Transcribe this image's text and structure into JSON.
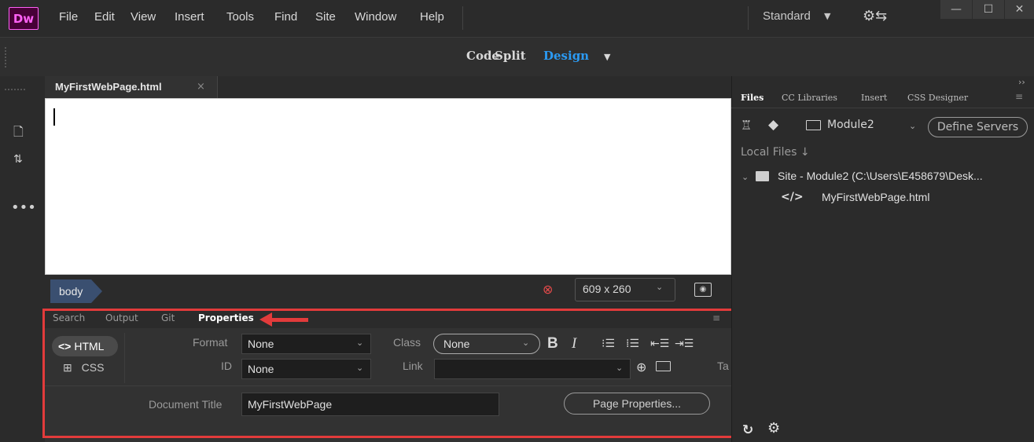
{
  "app": {
    "logo": "Dw",
    "menu": [
      "File",
      "Edit",
      "View",
      "Insert",
      "Tools",
      "Find",
      "Site",
      "Window",
      "Help"
    ],
    "workspace": "Standard",
    "window_buttons": [
      "—",
      "☐",
      "✕"
    ]
  },
  "view_toggle": {
    "code": "Code",
    "split": "Split",
    "design": "Design",
    "active": "Design",
    "active_color": "#2b9af3"
  },
  "document": {
    "tab_label": "MyFirstWebPage.html",
    "close_glyph": "×"
  },
  "status": {
    "tag": "body",
    "size": "609 x 260"
  },
  "properties_panel": {
    "tabs": [
      "Search",
      "Output",
      "Git",
      "Properties"
    ],
    "active_tab": "Properties",
    "html_label": "HTML",
    "css_label": "CSS",
    "format_label": "Format",
    "format_value": "None",
    "id_label": "ID",
    "id_value": "None",
    "class_label": "Class",
    "class_value": "None",
    "link_label": "Link",
    "link_value": "",
    "target_label": "Ta",
    "bold": "B",
    "italic": "I",
    "document_title_label": "Document Title",
    "document_title_value": "MyFirstWebPage",
    "page_properties_button": "Page Properties...",
    "highlight_color": "#e23b3b"
  },
  "files_panel": {
    "tabs": [
      "Files",
      "CC Libraries",
      "Insert",
      "CSS Designer"
    ],
    "active_tab": "Files",
    "site": "Module2",
    "define_servers": "Define Servers",
    "local_files": "Local Files",
    "site_entry": "Site - Module2 (C:\\Users\\E458679\\Desk...",
    "file": "MyFirstWebPage.html"
  },
  "icons": {
    "file_new": "new-document-icon",
    "file_transfer": "get-put-icon",
    "more": "more-icon",
    "settings_sync": "sync-settings-icon",
    "refresh": "refresh-icon",
    "manage_site": "manage-sites-icon"
  }
}
